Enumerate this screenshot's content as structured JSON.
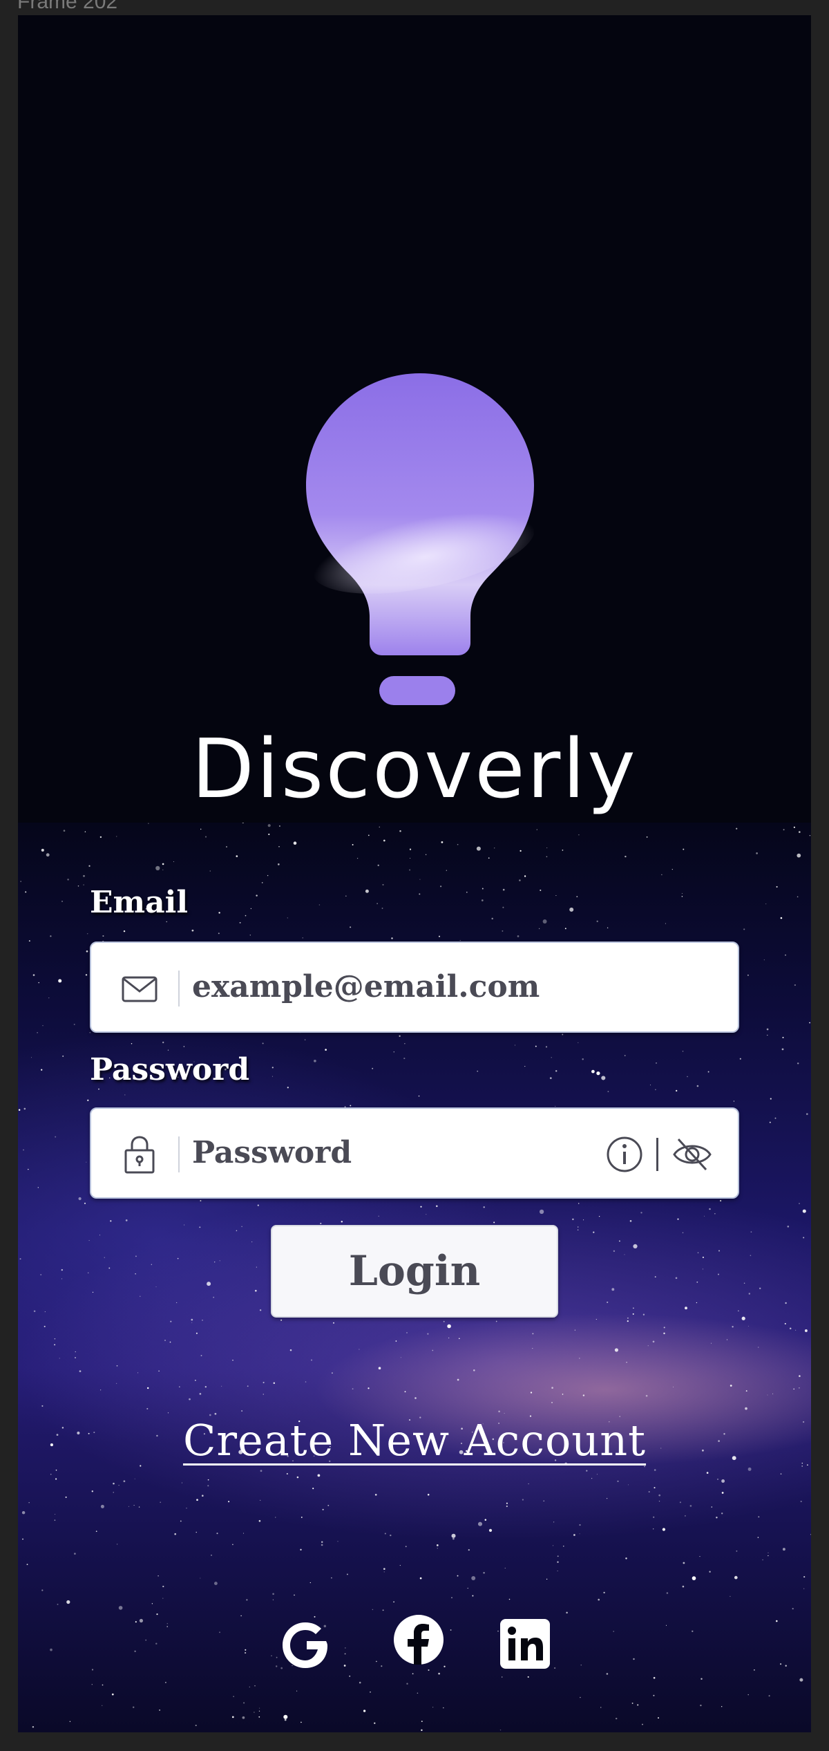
{
  "frame": {
    "label": "Frame 202"
  },
  "brand": {
    "name": "Discoverly",
    "logo_icon": "lightbulb-icon"
  },
  "colors": {
    "background_top": "#04050f",
    "bulb_gradient": [
      "#8d70e8",
      "#b9a0f4"
    ],
    "input_text": "#4a4a55",
    "white": "#ffffff"
  },
  "form": {
    "email_label": "Email",
    "email_placeholder": "example@email.com",
    "email_icon": "mail-icon",
    "password_label": "Password",
    "password_placeholder": "Password",
    "password_icon": "lock-icon",
    "info_icon": "info-icon",
    "visibility_icon": "eye-slash-icon",
    "login_label": "Login"
  },
  "links": {
    "create_account": "Create New Account"
  },
  "social": [
    {
      "name": "Google",
      "icon": "google-icon"
    },
    {
      "name": "Facebook",
      "icon": "facebook-icon"
    },
    {
      "name": "LinkedIn",
      "icon": "linkedin-icon"
    }
  ]
}
